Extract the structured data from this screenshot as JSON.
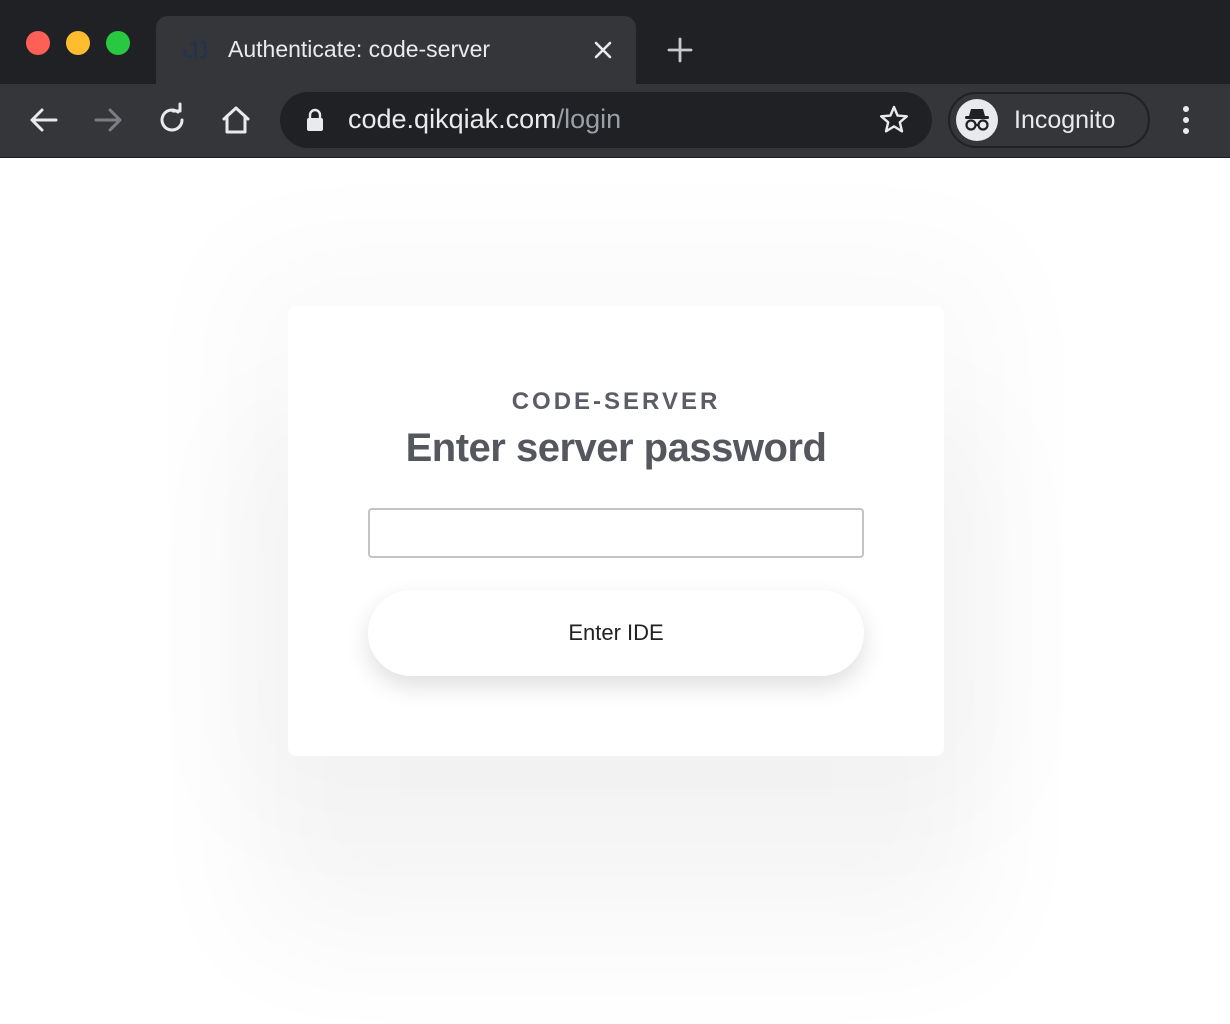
{
  "window": {
    "traffic_lights": [
      "close",
      "minimize",
      "maximize"
    ]
  },
  "tab": {
    "title": "Authenticate: code-server",
    "favicon": "code-server-logo-icon",
    "close_icon": "close-icon",
    "new_tab_icon": "plus-icon"
  },
  "toolbar": {
    "back_icon": "arrow-left-icon",
    "forward_icon": "arrow-right-icon",
    "reload_icon": "reload-icon",
    "home_icon": "home-icon",
    "url_host": "code.qikqiak.com",
    "url_path": "/login",
    "lock_icon": "lock-icon",
    "bookmark_icon": "star-icon",
    "profile_label": "Incognito",
    "menu_icon": "kebab-menu-icon"
  },
  "login": {
    "brand": "CODE-SERVER",
    "heading": "Enter server password",
    "password_value": "",
    "submit_label": "Enter IDE"
  },
  "colors": {
    "chrome_dark": "#202124",
    "chrome_mid": "#35363a",
    "heading_text": "#55575f"
  }
}
